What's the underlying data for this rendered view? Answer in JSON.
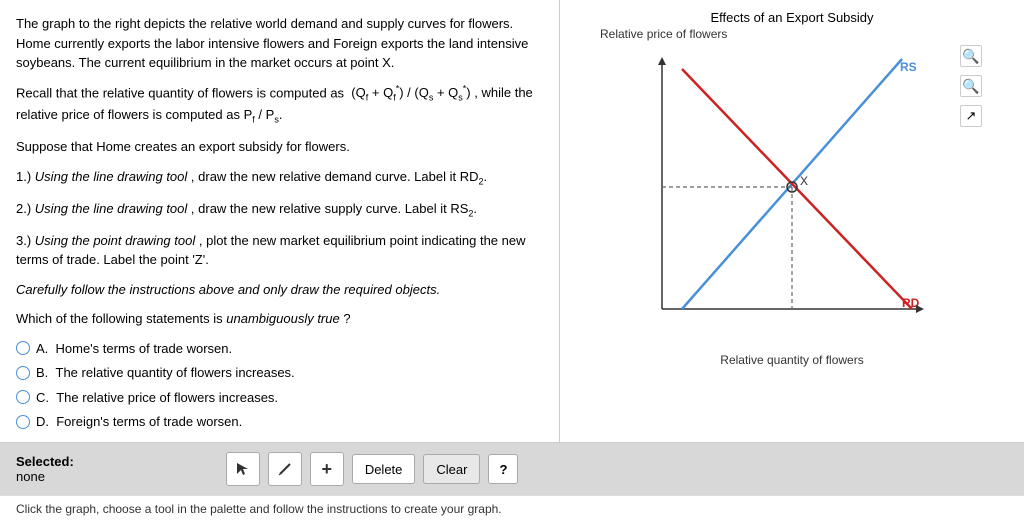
{
  "left": {
    "intro": "The graph to the right depicts the relative world demand and supply curves for flowers. Home currently exports the labor intensive flowers and Foreign exports the land intensive soybeans. The current equilibrium in the market occurs at point X.",
    "recall": "Recall that the relative quantity of flowers is computed as",
    "formula_num": "(Q",
    "formula_f": "f",
    "formula_plus": " + Q",
    "formula_fstar": "f",
    "formula_fstar_sup": "*",
    "formula_div": ") / (",
    "formula_qs": "Q",
    "formula_s": "s",
    "formula_plus2": " + Q",
    "formula_sstar": "s",
    "formula_sstar_sup": "*",
    "formula_end": ")",
    "recall_suffix": ", while the relative price of flowers is computed as P",
    "pf": "f",
    "ps": "s",
    "suppose": "Suppose that Home creates an export subsidy for flowers.",
    "q1_label": "1.)",
    "q1_tool": "Using the line drawing tool",
    "q1_text": ", draw the new relative demand curve. Label it RD",
    "q1_sub": "2",
    "q1_end": ".",
    "q2_label": "2.)",
    "q2_tool": "Using the line drawing tool",
    "q2_text": ", draw the new relative supply curve. Label it RS",
    "q2_sub": "2",
    "q2_end": ".",
    "q3_label": "3.)",
    "q3_tool": "Using the point drawing tool",
    "q3_text": ", plot the new market equilibrium point indicating the new terms of trade. Label the point 'Z'.",
    "q4": "Carefully follow the instructions above and only draw the required objects.",
    "q5_prefix": "Which of the following statements is ",
    "q5_italic": "unambiguously true",
    "q5_suffix": "?",
    "options": [
      {
        "letter": "A.",
        "text": "Home's terms of trade worsen."
      },
      {
        "letter": "B.",
        "text": "The relative quantity of flowers increases."
      },
      {
        "letter": "C.",
        "text": "The relative price of flowers increases."
      },
      {
        "letter": "D.",
        "text": "Foreign's terms of trade worsen."
      }
    ]
  },
  "graph": {
    "title": "Effects of an Export Subsidy",
    "y_label": "Relative price of flowers",
    "x_label": "Relative quantity of flowers",
    "rs_label": "RS",
    "rd_label": "RD",
    "x_point_label": "X"
  },
  "toolbar": {
    "selected_label": "Selected:",
    "selected_value": "none",
    "delete_label": "Delete",
    "clear_label": "Clear",
    "help_label": "?"
  },
  "footer": {
    "text": "Click the graph, choose a tool in the palette and follow the instructions to create your graph."
  },
  "icons": {
    "search": "🔍",
    "zoom_in": "🔍",
    "export": "↗"
  }
}
